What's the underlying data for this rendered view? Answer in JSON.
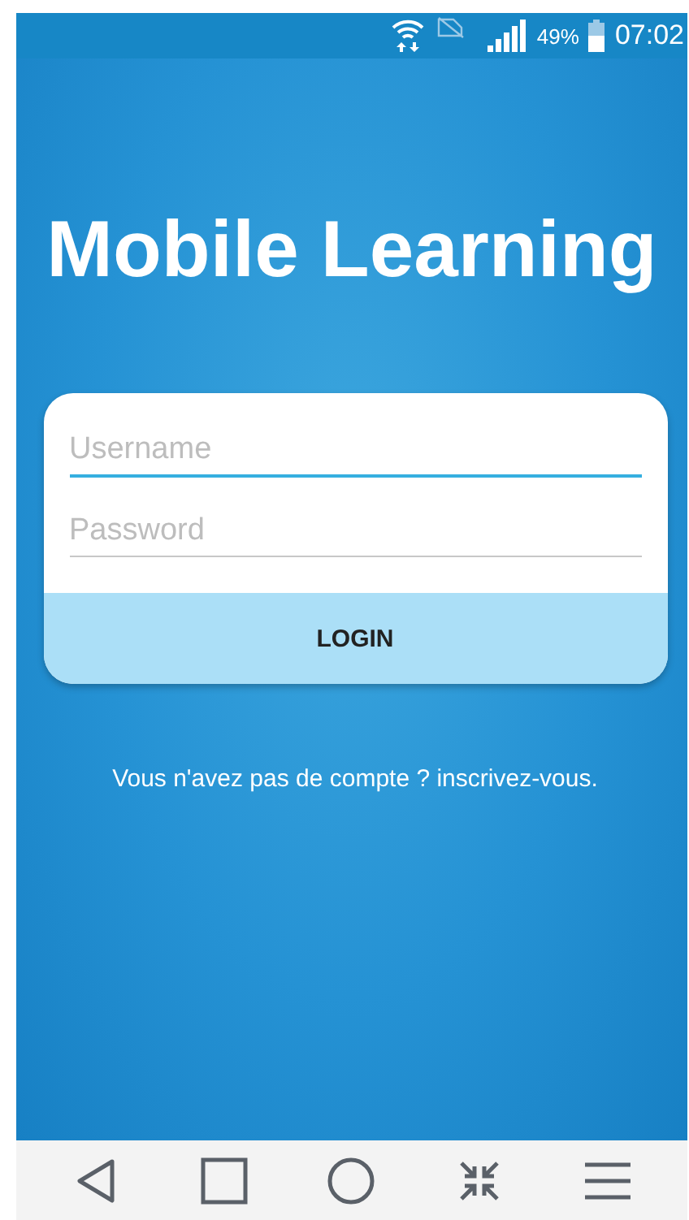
{
  "status_bar": {
    "battery": "49%",
    "time": "07:02"
  },
  "title": "Mobile Learning",
  "login_form": {
    "fields": [
      {
        "placeholder": "Username",
        "focused": true
      },
      {
        "placeholder": "Password",
        "focused": false
      }
    ],
    "button": "LOGIN"
  },
  "signup_link": "Vous n'avez pas de compte ? inscrivez-vous."
}
